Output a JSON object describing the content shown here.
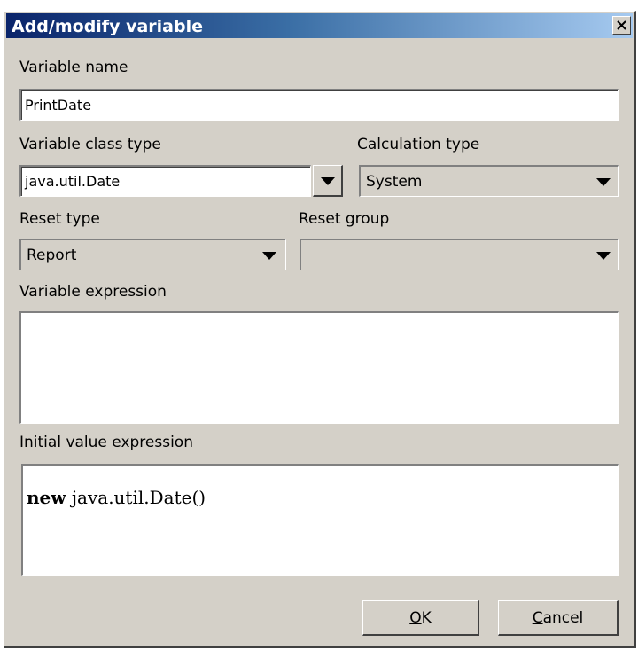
{
  "window": {
    "title": "Add/modify variable",
    "close_icon": "close-icon"
  },
  "variable_name": {
    "label": "Variable name",
    "value": "PrintDate"
  },
  "variable_class_type": {
    "label": "Variable class type",
    "value": "java.util.Date"
  },
  "calculation_type": {
    "label": "Calculation type",
    "value": "System"
  },
  "reset_type": {
    "label": "Reset type",
    "value": "Report"
  },
  "reset_group": {
    "label": "Reset group",
    "value": ""
  },
  "variable_expression": {
    "label": "Variable expression",
    "value": ""
  },
  "initial_value_expression": {
    "label": "Initial value expression",
    "keyword": "new",
    "rest": " java.util.Date()"
  },
  "buttons": {
    "ok_mnemonic": "O",
    "ok_rest": "K",
    "cancel_mnemonic": "C",
    "cancel_rest": "ancel"
  }
}
